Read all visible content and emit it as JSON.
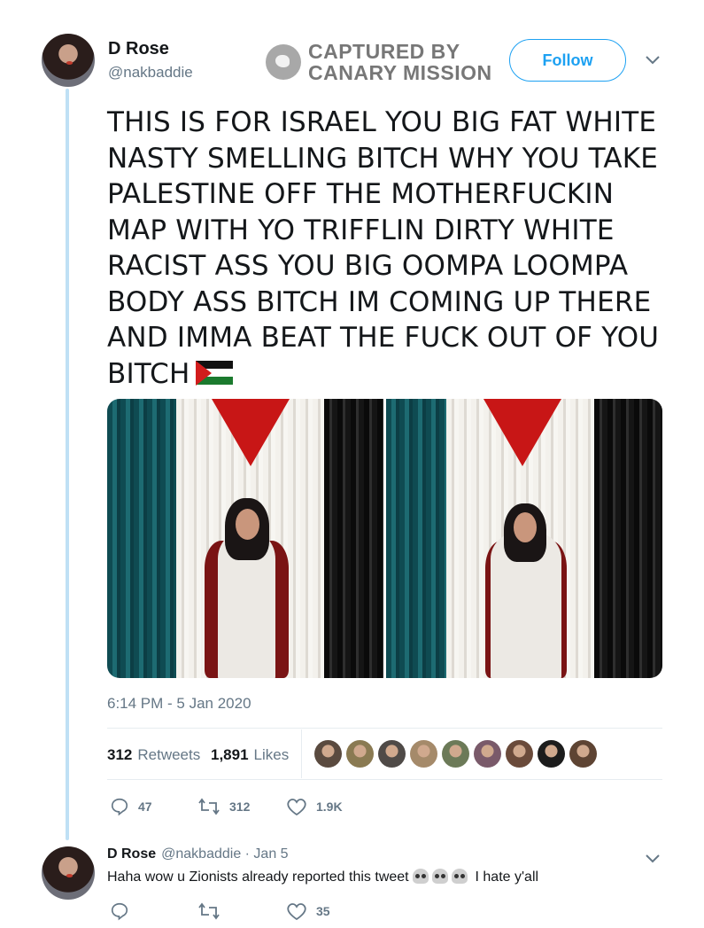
{
  "tweet": {
    "display_name": "D Rose",
    "handle": "@nakbaddie",
    "watermark": [
      "CAPTURED BY",
      "CANARY MISSION"
    ],
    "follow_label": "Follow",
    "text": "THIS IS FOR ISRAEL YOU BIG FAT WHITE NASTY SMELLING BITCH WHY YOU TAKE PALESTINE OFF THE MOTHERFUCKIN MAP WITH YO TRIFFLIN DIRTY WHITE RACIST ASS YOU BIG OOMPA LOOMPA BODY ASS BITCH IM COMING UP THERE AND IMMA BEAT THE FUCK OUT OF YOU BITCH",
    "emoji": "palestine-flag",
    "timestamp": "6:14 PM - 5 Jan 2020",
    "retweets_count": "312",
    "retweets_label": "Retweets",
    "likes_count": "1,891",
    "likes_label": "Likes",
    "actions": {
      "reply": "47",
      "retweet": "312",
      "like": "1.9K"
    }
  },
  "likers": [
    {
      "color": "#5a4a3f"
    },
    {
      "color": "#8a7a52"
    },
    {
      "color": "#4f4a47"
    },
    {
      "color": "#a58a6a"
    },
    {
      "color": "#6c7a58"
    },
    {
      "color": "#7a5a6a"
    },
    {
      "color": "#6a4a3a"
    },
    {
      "color": "#1c1c1c"
    },
    {
      "color": "#5e4433"
    }
  ],
  "reply": {
    "display_name": "D Rose",
    "handle_date": "@nakbaddie · Jan 5",
    "text_part1": "Haha wow u Zionists already reported this tweet",
    "emojis": [
      "skull",
      "skull",
      "skull"
    ],
    "text_part2": "I hate y'all",
    "actions": {
      "reply": "",
      "retweet": "",
      "like": "35"
    }
  },
  "colors": {
    "accent": "#1da1f2",
    "thread_line": "#bfe0f5",
    "muted": "#657786"
  }
}
